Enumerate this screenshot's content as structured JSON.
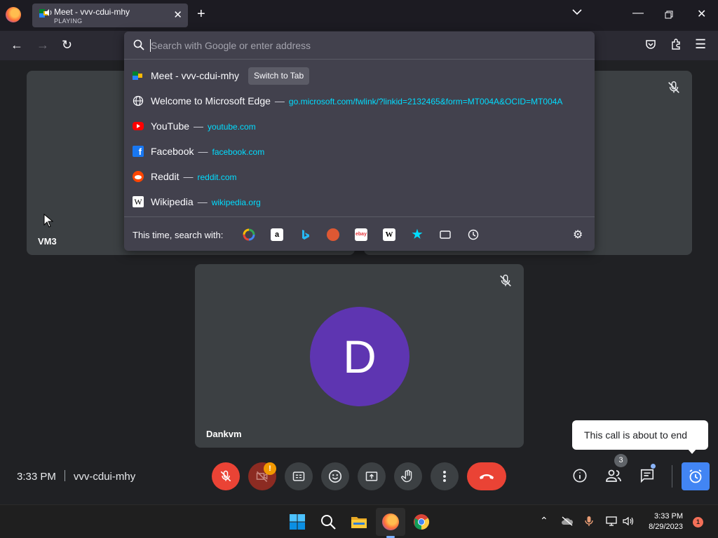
{
  "browser": {
    "tab": {
      "title": "Meet - vvv-cdui-mhy",
      "status": "PLAYING"
    },
    "icons": {
      "app": "firefox-icon",
      "new_tab": "plus-icon",
      "list_tabs": "chevron-down-icon",
      "back": "back-arrow-icon",
      "forward": "forward-arrow-icon",
      "reload": "reload-icon",
      "pocket": "pocket-icon",
      "extensions": "puzzle-icon",
      "menu": "hamburger-icon"
    }
  },
  "urlbar": {
    "placeholder": "Search with Google or enter address",
    "results": [
      {
        "title": "Meet - vvv-cdui-mhy",
        "action": "Switch to Tab",
        "icon": "meet-icon"
      },
      {
        "title": "Welcome to Microsoft Edge",
        "url": "go.microsoft.com/fwlink/?linkid=2132465&form=MT004A&OCID=MT004A",
        "icon": "globe-icon"
      },
      {
        "title": "YouTube",
        "url": "youtube.com",
        "icon": "youtube-icon"
      },
      {
        "title": "Facebook",
        "url": "facebook.com",
        "icon": "facebook-icon"
      },
      {
        "title": "Reddit",
        "url": "reddit.com",
        "icon": "reddit-icon"
      },
      {
        "title": "Wikipedia",
        "url": "wikipedia.org",
        "icon": "wikipedia-icon"
      }
    ],
    "separator": "—",
    "search_with_label": "This time, search with:",
    "engines": [
      "google-icon",
      "amazon-icon",
      "bing-icon",
      "duckduckgo-icon",
      "ebay-icon",
      "wikipedia-icon",
      "bookmarks-icon",
      "tabs-icon",
      "history-icon"
    ],
    "engine_glyphs": {
      "amazon": "a",
      "ebay": "ebay",
      "wikipedia": "W"
    }
  },
  "meet": {
    "tiles": [
      {
        "name": "VM3"
      },
      {
        "name": "Dankvm",
        "initial": "D"
      }
    ],
    "time": "3:33 PM",
    "meeting_code": "vvv-cdui-mhy",
    "camera_warning": "!",
    "participants_count": "3",
    "tooltip": "This call is about to end",
    "colors": {
      "end_call": "#ea4335",
      "avatar": "#5e35b1",
      "accent": "#4285f4"
    }
  },
  "taskbar": {
    "time": "3:33 PM",
    "date": "8/29/2023",
    "notifications": "1",
    "apps": [
      "windows-start-icon",
      "search-icon",
      "file-explorer-icon",
      "firefox-icon",
      "chrome-icon"
    ]
  }
}
